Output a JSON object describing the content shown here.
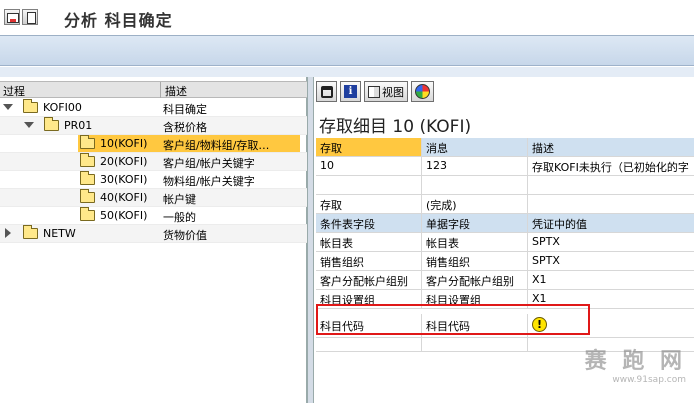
{
  "window": {
    "title": "分析 科目确定"
  },
  "left_panel": {
    "columns": [
      "过程",
      "描述"
    ],
    "rows": [
      {
        "label": "KOFI00",
        "desc": "科目确定",
        "level": 0,
        "expander": "open"
      },
      {
        "label": "PR01",
        "desc": "含税价格",
        "level": 1,
        "expander": "open"
      },
      {
        "label": "10(KOFI)",
        "desc": "客户组/物料组/存取…",
        "level": 2,
        "expander": "",
        "selected": true
      },
      {
        "label": "20(KOFI)",
        "desc": "客户组/帐户关键字",
        "level": 2,
        "expander": ""
      },
      {
        "label": "30(KOFI)",
        "desc": "物料组/帐户关键字",
        "level": 2,
        "expander": ""
      },
      {
        "label": "40(KOFI)",
        "desc": "帐户键",
        "level": 2,
        "expander": ""
      },
      {
        "label": "50(KOFI)",
        "desc": "一般的",
        "level": 2,
        "expander": ""
      },
      {
        "label": "NETW",
        "desc": "货物价值",
        "level": 0,
        "expander": "closed"
      }
    ]
  },
  "right_panel": {
    "toolbar": {
      "view_label": "视图"
    },
    "heading": "存取细目 10 (KOFI)",
    "table1": {
      "headers": [
        "存取",
        "消息",
        "描述"
      ],
      "row": [
        "10",
        "123",
        "存取KOFI未执行（已初始化的字"
      ]
    },
    "status_row": [
      "存取",
      "(完成)"
    ],
    "table2": {
      "headers": [
        "条件表字段",
        "单据字段",
        "凭证中的值"
      ],
      "rows": [
        [
          "帐目表",
          "帐目表",
          "SPTX"
        ],
        [
          "销售组织",
          "销售组织",
          "SPTX"
        ],
        [
          "客户分配帐户组别",
          "客户分配帐户组别",
          "X1"
        ],
        [
          "科目设置组",
          "科目设置组",
          "X1"
        ],
        [
          "科目代码",
          "科目代码",
          ""
        ]
      ]
    }
  },
  "watermark": {
    "text": "赛 跑 网",
    "url": "www.91sap.com"
  }
}
